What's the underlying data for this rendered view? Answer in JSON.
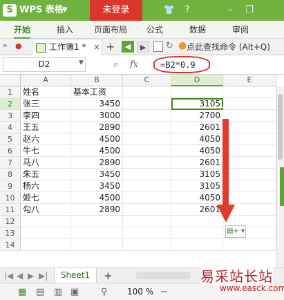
{
  "titlebar": {
    "logo": "S",
    "app_name": "WPS 表格",
    "dropdown": "▼",
    "login_button": "未登录",
    "shirt_icon": "👕",
    "help_icon": "?",
    "dash": "–",
    "restore_icon": "❐"
  },
  "ribbon": {
    "tabs": [
      "开始",
      "插入",
      "页面布局",
      "公式",
      "数据",
      "审阅"
    ]
  },
  "toolbar": {
    "doc_tab_label": "工作簿1 *",
    "doc_tab_close": "×",
    "new_tab": "+",
    "find_command": "点此查找命令 (Alt+Q)"
  },
  "formula_bar": {
    "name_box": "D2",
    "fx": "fx",
    "formula": "=B2*0.9"
  },
  "columns": [
    "A",
    "B",
    "C",
    "D",
    "E"
  ],
  "rows": [
    "1",
    "2",
    "3",
    "4",
    "5",
    "6",
    "7",
    "8",
    "9",
    "10",
    "11",
    "12",
    "13",
    "14"
  ],
  "table": {
    "header": {
      "name": "姓名",
      "salary": "基本工资"
    },
    "data": [
      {
        "name": "张三",
        "salary": "3450",
        "d": "3105"
      },
      {
        "name": "李四",
        "salary": "3000",
        "d": "2700"
      },
      {
        "name": "王五",
        "salary": "2890",
        "d": "2601"
      },
      {
        "name": "赵六",
        "salary": "4500",
        "d": "4050"
      },
      {
        "name": "牛七",
        "salary": "4500",
        "d": "4050"
      },
      {
        "name": "马八",
        "salary": "2890",
        "d": "2601"
      },
      {
        "name": "朱五",
        "salary": "3450",
        "d": "3105"
      },
      {
        "name": "杨六",
        "salary": "3450",
        "d": "3105"
      },
      {
        "name": "姬七",
        "salary": "4500",
        "d": "4050"
      },
      {
        "name": "勾八",
        "salary": "2890",
        "d": "2601"
      }
    ]
  },
  "sheets": {
    "active": "Sheet1",
    "add": "+"
  },
  "status": {
    "zoom": "100 %"
  },
  "watermark": {
    "brand": "易采站长站",
    "url": "www.easck.com"
  },
  "colors": {
    "brand_green": "#6fb23f",
    "login_red": "#d9372b",
    "annotation_red": "#e33a2c"
  }
}
